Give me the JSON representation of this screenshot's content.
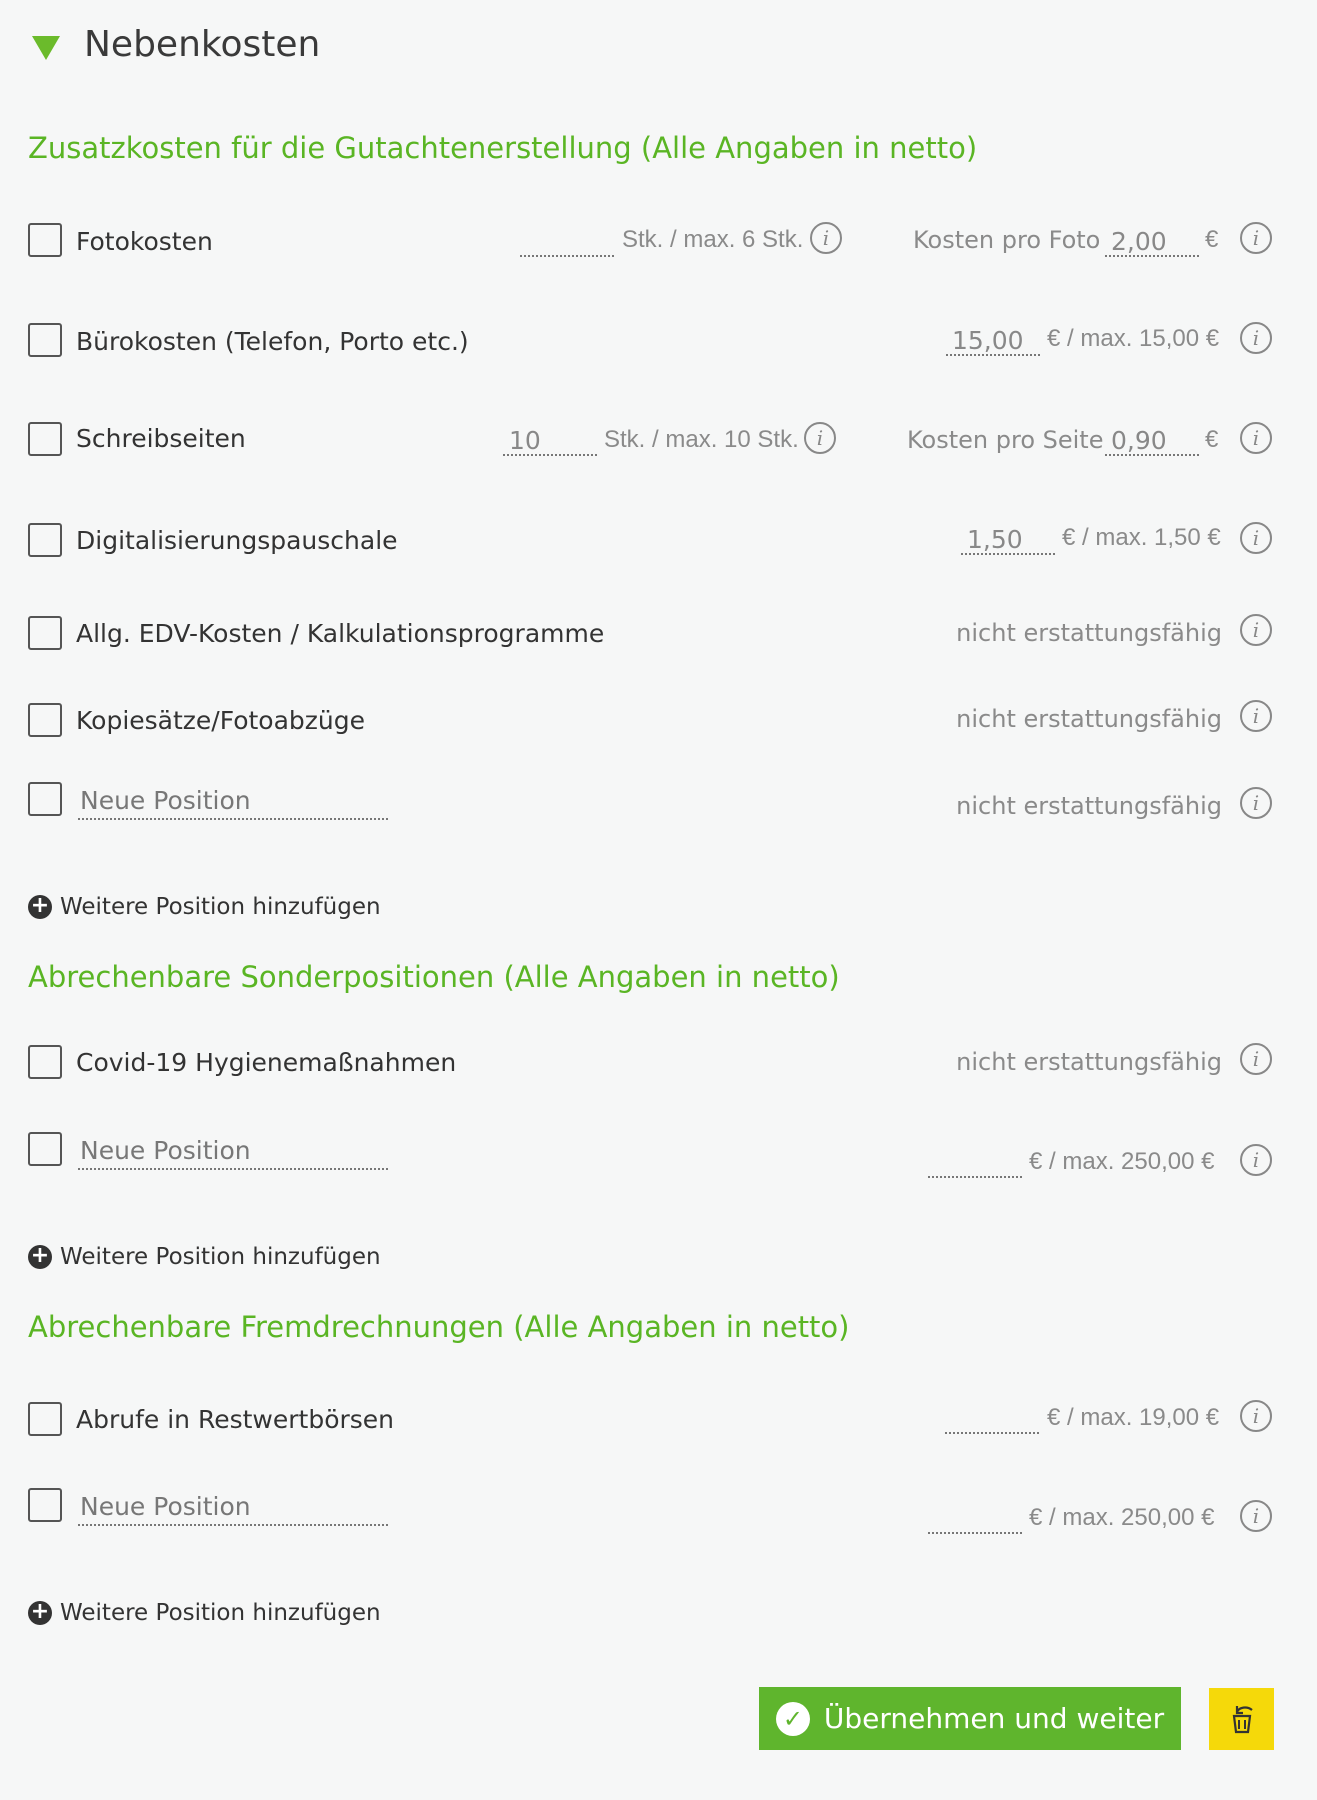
{
  "header": {
    "title": "Nebenkosten",
    "toggle_icon": "triangle-down-icon"
  },
  "sections": {
    "zusatz": {
      "title": "Zusatzkosten für die Gutachtenerstellung (Alle Angaben in netto)",
      "fotokosten": {
        "label": "Fotokosten",
        "qty_value": "",
        "qty_unit": "Stk. / max. 6 Stk.",
        "price_label": "Kosten pro Foto",
        "price_value": "2,00",
        "currency": "€"
      },
      "buerokosten": {
        "label": "Bürokosten (Telefon, Porto etc.)",
        "value": "15,00",
        "unit": "€ / max. 15,00 €"
      },
      "schreibseiten": {
        "label": "Schreibseiten",
        "qty_value": "10",
        "qty_unit": "Stk. / max. 10 Stk.",
        "price_label": "Kosten pro Seite",
        "price_value": "0,90",
        "currency": "€"
      },
      "digital": {
        "label": "Digitalisierungspauschale",
        "value": "1,50",
        "unit": "€ / max. 1,50 €"
      },
      "edv": {
        "label": "Allg. EDV-Kosten / Kalkulationsprogramme",
        "status": "nicht erstattungsfähig"
      },
      "kopie": {
        "label": "Kopiesätze/Fotoabzüge",
        "status": "nicht erstattungsfähig"
      },
      "neu": {
        "placeholder": "Neue Position",
        "status": "nicht erstattungsfähig"
      },
      "add_label": "Weitere Position hinzufügen"
    },
    "sonder": {
      "title": "Abrechenbare Sonderpositionen (Alle Angaben in netto)",
      "covid": {
        "label": "Covid-19 Hygienemaßnahmen",
        "status": "nicht erstattungsfähig"
      },
      "neu": {
        "placeholder": "Neue Position",
        "value": "",
        "unit": "€ / max. 250,00 €"
      },
      "add_label": "Weitere Position hinzufügen"
    },
    "fremd": {
      "title": "Abrechenbare Fremdrechnungen (Alle Angaben in netto)",
      "restwert": {
        "label": "Abrufe in Restwertbörsen",
        "value": "",
        "unit": "€ / max. 19,00 €"
      },
      "neu": {
        "placeholder": "Neue Position",
        "value": "",
        "unit": "€ / max. 250,00 €"
      },
      "add_label": "Weitere Position hinzufügen"
    }
  },
  "info_glyph": "i",
  "footer": {
    "apply_label": "Übernehmen und weiter",
    "apply_icon": "check-circle-icon",
    "reset_icon": "trash-undo-icon"
  },
  "colors": {
    "accent": "#5fb52d",
    "reset_button": "#f5d90a",
    "background": "#f6f7f7"
  }
}
